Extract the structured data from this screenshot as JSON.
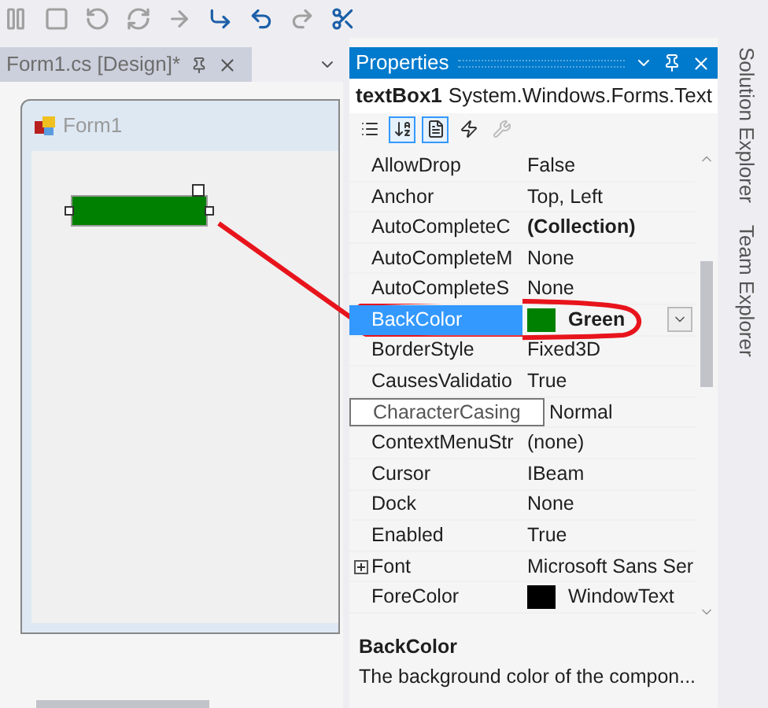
{
  "toolbar": {
    "buttons": [
      {
        "kind": "pause",
        "disabled": true
      },
      {
        "kind": "stop",
        "disabled": true
      },
      {
        "kind": "restart",
        "disabled": true
      },
      {
        "kind": "refresh",
        "disabled": true
      },
      {
        "kind": "next",
        "disabled": true
      },
      {
        "kind": "step-into",
        "disabled": false
      },
      {
        "kind": "step-over",
        "disabled": false
      },
      {
        "kind": "step-out",
        "disabled": true
      },
      {
        "kind": "tools",
        "disabled": false
      }
    ]
  },
  "document_tab": {
    "title": "Form1.cs [Design]*",
    "selected": true
  },
  "form": {
    "title": "Form1",
    "textbox": {
      "color": "#008000",
      "selected": true
    }
  },
  "properties": {
    "title": "Properties",
    "object_name": "textBox1",
    "object_type": "System.Windows.Forms.Text",
    "tools": [
      {
        "kind": "categorized",
        "selected": false
      },
      {
        "kind": "alphabetical",
        "selected": true
      },
      {
        "kind": "properties",
        "selected": true
      },
      {
        "kind": "events",
        "selected": false
      },
      {
        "kind": "property-pages",
        "selected": false
      }
    ],
    "rows": [
      {
        "name": "AllowDrop",
        "value": "False",
        "bold": false,
        "selected": false,
        "hovered": false,
        "expandable": false
      },
      {
        "name": "Anchor",
        "value": "Top, Left",
        "bold": false,
        "selected": false,
        "hovered": false,
        "expandable": false
      },
      {
        "name": "AutoCompleteC",
        "value": "(Collection)",
        "bold": true,
        "selected": false,
        "hovered": false,
        "expandable": false
      },
      {
        "name": "AutoCompleteM",
        "value": "None",
        "bold": false,
        "selected": false,
        "hovered": false,
        "expandable": false
      },
      {
        "name": "AutoCompleteS",
        "value": "None",
        "bold": false,
        "selected": false,
        "hovered": false,
        "expandable": false
      },
      {
        "name": "BackColor",
        "value": "Green",
        "color": "#008000",
        "bold": true,
        "selected": true,
        "hovered": false,
        "expandable": false
      },
      {
        "name": "BorderStyle",
        "value": "Fixed3D",
        "bold": false,
        "selected": false,
        "hovered": false,
        "expandable": false
      },
      {
        "name": "CausesValidatio",
        "value": "True",
        "bold": false,
        "selected": false,
        "hovered": false,
        "expandable": false
      },
      {
        "name": "CharacterCasing",
        "value": "Normal",
        "bold": false,
        "selected": false,
        "hovered": true,
        "expandable": false
      },
      {
        "name": "ContextMenuStr",
        "value": "(none)",
        "bold": false,
        "selected": false,
        "hovered": false,
        "expandable": false
      },
      {
        "name": "Cursor",
        "value": "IBeam",
        "bold": false,
        "selected": false,
        "hovered": false,
        "expandable": false
      },
      {
        "name": "Dock",
        "value": "None",
        "bold": false,
        "selected": false,
        "hovered": false,
        "expandable": false
      },
      {
        "name": "Enabled",
        "value": "True",
        "bold": false,
        "selected": false,
        "hovered": false,
        "expandable": false
      },
      {
        "name": "Font",
        "value": "Microsoft Sans Ser",
        "bold": false,
        "selected": false,
        "hovered": false,
        "expandable": true
      },
      {
        "name": "ForeColor",
        "value": "WindowText",
        "color": "#000000",
        "bold": false,
        "selected": false,
        "hovered": false,
        "expandable": false
      }
    ],
    "description": {
      "title": "BackColor",
      "text": "The background color of the compon..."
    }
  },
  "side_tabs": [
    "Solution Explorer",
    "Team Explorer"
  ]
}
